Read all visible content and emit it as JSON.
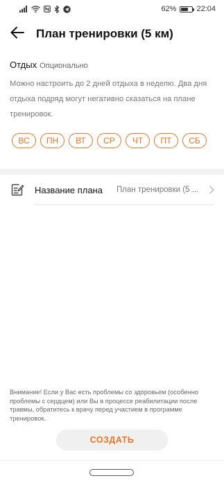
{
  "status_bar": {
    "battery_text": "62%",
    "battery_level": 0.62,
    "time": "22:04",
    "icons": [
      "signal-icon",
      "wifi-icon",
      "nfc-icon",
      "bluetooth-icon",
      "telegram-icon"
    ]
  },
  "app_bar": {
    "back_icon": "arrow-left-icon",
    "title": "План тренировки (5 км)"
  },
  "rest": {
    "title": "Отдых",
    "optional_label": "Опционально",
    "description": "Можно настроить до 2 дней отдыха в неделю. Два дня отдыха подряд могут негативно сказаться на плане тренировок.",
    "days": [
      {
        "label": "ВС"
      },
      {
        "label": "ПН"
      },
      {
        "label": "ВТ"
      },
      {
        "label": "СР"
      },
      {
        "label": "ЧТ"
      },
      {
        "label": "ПТ"
      },
      {
        "label": "СБ"
      }
    ]
  },
  "plan": {
    "icon": "edit-document-icon",
    "label": "Название плана",
    "value": "План тренировки (5 ...",
    "chevron": "chevron-right-icon"
  },
  "warning": "Внимание! Если у Вас есть проблемы со здоровьем (особенно проблемы с сердцем) или Вы в процессе реабилитации после травмы, обратитесь к врачу перед участием в программе тренировок.",
  "create_button": "СОЗДАТЬ",
  "colors": {
    "accent": "#e8742b",
    "background": "#ffffff",
    "divider": "#f1f1f1"
  }
}
